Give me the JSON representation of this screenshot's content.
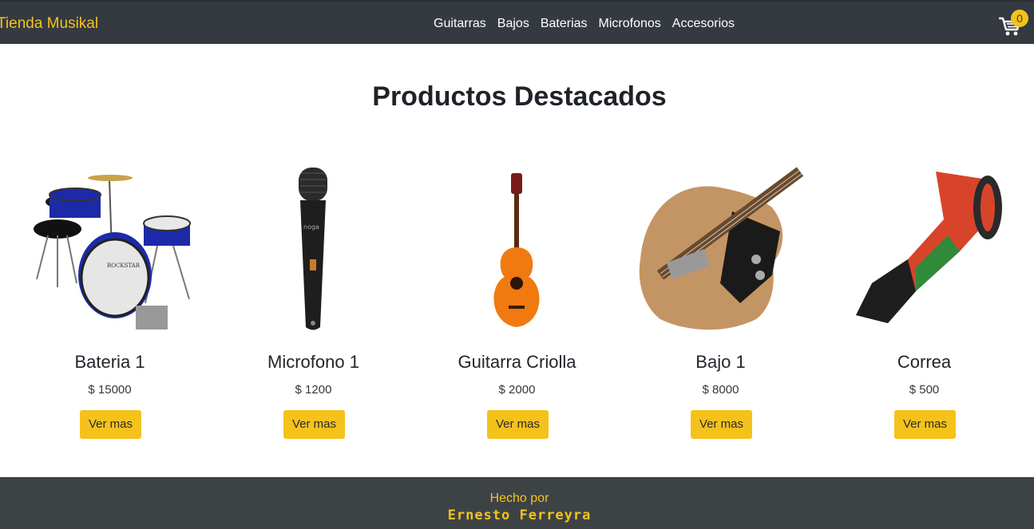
{
  "brand": {
    "name": "Tienda Musikal",
    "accent": "#f5c21b"
  },
  "nav": {
    "links": [
      "Guitarras",
      "Bajos",
      "Baterias",
      "Microfonos",
      "Accesorios"
    ]
  },
  "cart": {
    "icon": "cart-icon",
    "count": "0"
  },
  "main": {
    "title": "Productos Destacados"
  },
  "products": [
    {
      "name": "Bateria 1",
      "price": "$ 15000",
      "button": "Ver mas",
      "image": "drum-kit-image"
    },
    {
      "name": "Microfono 1",
      "price": "$ 1200",
      "button": "Ver mas",
      "image": "microphone-image"
    },
    {
      "name": "Guitarra Criolla",
      "price": "$ 2000",
      "button": "Ver mas",
      "image": "classical-guitar-image"
    },
    {
      "name": "Bajo 1",
      "price": "$ 8000",
      "button": "Ver mas",
      "image": "bass-guitar-image"
    },
    {
      "name": "Correa",
      "price": "$ 500",
      "button": "Ver mas",
      "image": "guitar-strap-image"
    }
  ],
  "footer": {
    "made_by": "Hecho por",
    "author": "Ernesto Ferreyra"
  },
  "colors": {
    "navbar": "#343a40",
    "footer": "#3d4345",
    "button": "#f5c21b"
  }
}
